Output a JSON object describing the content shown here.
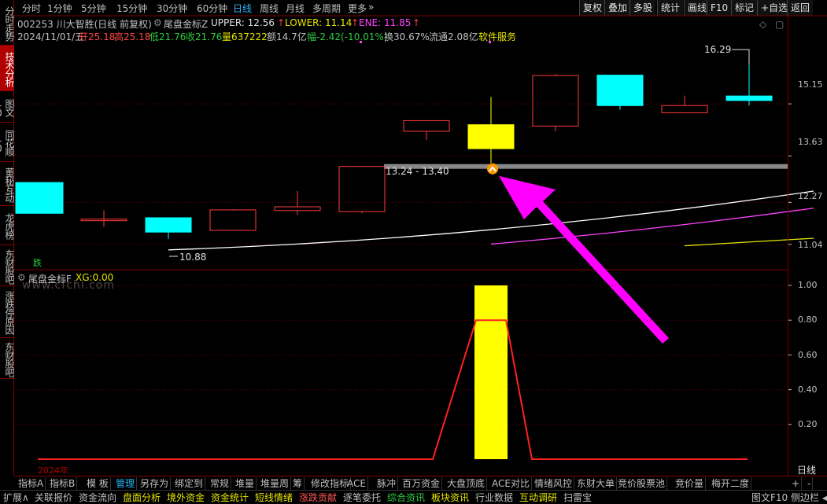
{
  "sidebar": {
    "tabs": [
      {
        "label": "分时走势",
        "active": false
      },
      {
        "label": "技术分析",
        "active": true
      },
      {
        "label": "图文10",
        "active": false
      },
      {
        "label": "同花顺10",
        "active": false
      },
      {
        "label": "董秘互动",
        "active": false
      },
      {
        "label": "龙虎榜",
        "active": false
      },
      {
        "label": "东财股吧",
        "active": false
      },
      {
        "label": "涨跌停原因",
        "active": false
      },
      {
        "label": "东财股吧",
        "active": false
      }
    ]
  },
  "periods": [
    {
      "label": "分时",
      "active": false
    },
    {
      "label": "1分钟",
      "active": false
    },
    {
      "label": "5分钟",
      "active": false
    },
    {
      "label": "15分钟",
      "active": false
    },
    {
      "label": "30分钟",
      "active": false
    },
    {
      "label": "60分钟",
      "active": false
    },
    {
      "label": "日线",
      "active": true
    },
    {
      "label": "周线",
      "active": false
    },
    {
      "label": "月线",
      "active": false
    },
    {
      "label": "多周期",
      "active": false
    },
    {
      "label": "更多",
      "active": false
    }
  ],
  "toolbar_right": [
    "复权",
    "叠加",
    "多股",
    "统计",
    "画线",
    "F10",
    "标记",
    "+自选",
    "返回"
  ],
  "stock": {
    "title": "002253 川大智胜(日线 前复权)",
    "indicator_name": "尾盘金标Z",
    "upper": "UPPER: 12.56",
    "lower": "LOWER: 11.14",
    "ene": "ENE: 11.85",
    "date": "2024/11/01/五",
    "open": "开25.18",
    "high": "高25.18",
    "low": "低21.76",
    "close": "收21.76",
    "volume": "量637222",
    "amount": "额14.7亿",
    "change": "幅-2.42(-10.01%)",
    "turnover": "换30.67%",
    "float": "流通2.08亿",
    "sector": "软件服务"
  },
  "main_chart": {
    "annotations": {
      "high_label": "16.29",
      "low_label": "10.88",
      "zone_label": "13.24 - 13.40",
      "drop_badge": "跌"
    },
    "axis_ticks": [
      "15.15",
      "13.63",
      "12.27",
      "11.04"
    ]
  },
  "sub_chart": {
    "indicator": "尾盘金标F",
    "value": "XG:0.00",
    "axis_ticks": [
      "1.00",
      "0.80",
      "0.60",
      "0.40",
      "0.20"
    ],
    "year_label": "2024年",
    "period_label": "日线"
  },
  "watermark": "www.cfchi.com",
  "chart_data": {
    "type": "candlestick",
    "candles": [
      {
        "open": 12.85,
        "close": 11.95,
        "high": 12.85,
        "low": 11.95
      },
      {
        "open": 11.78,
        "close": 11.76,
        "high": 12.04,
        "low": 11.55
      },
      {
        "open": 11.4,
        "close": 11.82,
        "high": 11.82,
        "low": 11.2
      },
      {
        "open": 11.45,
        "close": 12.05,
        "high": 12.07,
        "low": 11.45
      },
      {
        "open": 12.03,
        "close": 12.14,
        "high": 12.6,
        "low": 11.9
      },
      {
        "open": 12.0,
        "close": 13.32,
        "high": 13.32,
        "low": 11.95
      },
      {
        "open": 14.35,
        "close": 14.66,
        "high": 14.66,
        "low": 14.1
      },
      {
        "open": 13.84,
        "close": 14.54,
        "high": 15.35,
        "low": 13.42
      },
      {
        "open": 14.5,
        "close": 15.98,
        "high": 16.02,
        "low": 14.35
      },
      {
        "open": 15.99,
        "close": 15.1,
        "high": 15.99,
        "low": 14.98
      },
      {
        "open": 15.1,
        "close": 14.89,
        "high": 15.39,
        "low": 14.89
      },
      {
        "open": 15.38,
        "close": 15.25,
        "high": 16.29,
        "low": 15.1
      }
    ],
    "candle_colors": [
      "cyan",
      "red",
      "cyan",
      "red",
      "red",
      "red",
      "red",
      "yellow",
      "red",
      "cyan",
      "red",
      "cyan"
    ],
    "ylim": [
      10.6,
      16.9
    ],
    "ma_white": [
      [
        2,
        10.88
      ],
      [
        12,
        12.6
      ]
    ],
    "ma_magenta": [
      [
        7,
        11.05
      ],
      [
        12,
        12.1
      ]
    ],
    "ma_yellow": [
      [
        10,
        11.0
      ],
      [
        12,
        11.22
      ]
    ],
    "support_zone": [
      13.24,
      13.4
    ],
    "xg_signal": [
      0,
      0,
      0,
      0,
      0,
      0,
      0,
      1,
      0,
      0,
      0,
      0
    ],
    "xg_line": [
      0,
      0,
      0,
      0,
      0,
      0,
      0,
      0.8,
      0,
      0,
      0,
      0
    ]
  }
}
